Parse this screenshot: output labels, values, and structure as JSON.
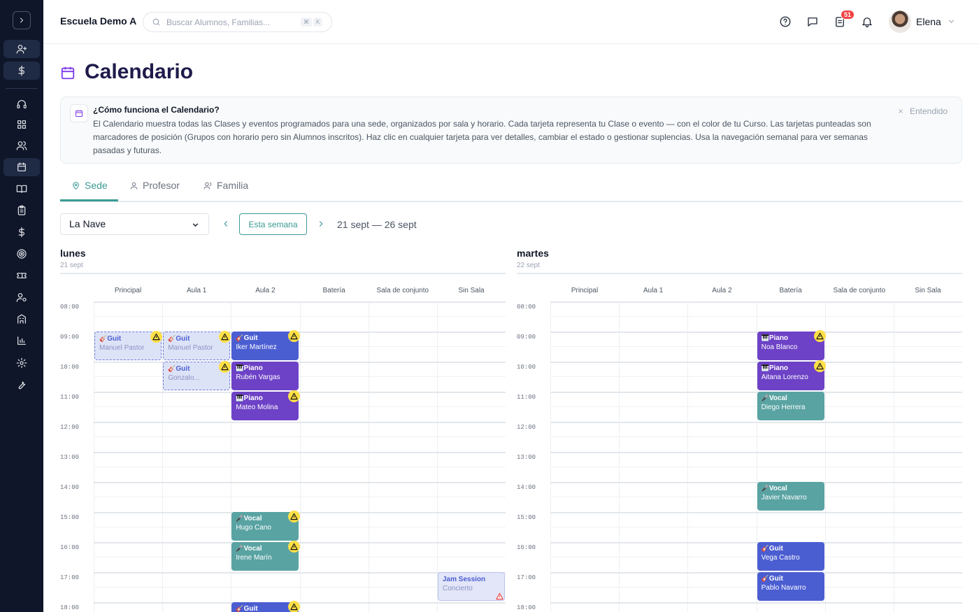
{
  "topbar": {
    "school": "Escuela Demo A",
    "search_placeholder": "Buscar Alumnos, Familias...",
    "kbd1": "⌘",
    "kbd2": "K",
    "badge_count": "51",
    "user_name": "Elena"
  },
  "page": {
    "title": "Calendario"
  },
  "info": {
    "title": "¿Cómo funciona el Calendario?",
    "text": "El Calendario muestra todas las Clases y eventos programados para una sede, organizados por sala y horario. Cada tarjeta representa tu Clase o evento — con el color de tu Curso. Las tarjetas punteadas son marcadores de posición (Grupos con horario pero sin Alumnos inscritos). Haz clic en cualquier tarjeta para ver detalles, cambiar el estado o gestionar suplencias. Usa la navegación semanal para ver semanas pasadas y futuras.",
    "dismiss": "Entendido"
  },
  "tabs": [
    {
      "label": "Sede",
      "icon": "map-pin-icon"
    },
    {
      "label": "Profesor",
      "icon": "user-icon"
    },
    {
      "label": "Familia",
      "icon": "users-icon"
    }
  ],
  "controls": {
    "venue": "La Nave",
    "this_week": "Esta semana",
    "range": "21 sept — 26 sept"
  },
  "rooms": [
    "Principal",
    "Aula 1",
    "Aula 2",
    "Batería",
    "Sala de conjunto",
    "Sin Sala"
  ],
  "times": [
    "08:00",
    "09:00",
    "10:00",
    "11:00",
    "12:00",
    "13:00",
    "14:00",
    "15:00",
    "16:00",
    "17:00",
    "18:00"
  ],
  "days": [
    {
      "name": "lunes",
      "date": "21 sept",
      "events": [
        {
          "room": 0,
          "hour": 1,
          "type": "ph",
          "icon": "🎸",
          "title": "Guit",
          "sub": "Manuel Pastor",
          "warn": true
        },
        {
          "room": 1,
          "hour": 1,
          "type": "ph",
          "icon": "🎸",
          "title": "Guit",
          "sub": "Manuel Pastor",
          "warn": true
        },
        {
          "room": 2,
          "hour": 1,
          "type": "guit",
          "icon": "🎸",
          "title": "Guit",
          "sub": "Iker Martínez",
          "warn": true
        },
        {
          "room": 1,
          "hour": 2,
          "type": "ph",
          "icon": "🎸",
          "title": "Guit",
          "sub": "Gonzalo...",
          "warn": true
        },
        {
          "room": 2,
          "hour": 2,
          "type": "piano",
          "icon": "🎹",
          "title": "Piano",
          "sub": "Rubén Vargas",
          "warn": false
        },
        {
          "room": 2,
          "hour": 3,
          "type": "piano",
          "icon": "🎹",
          "title": "Piano",
          "sub": "Mateo Molina",
          "warn": true
        },
        {
          "room": 2,
          "hour": 7,
          "type": "vocal",
          "icon": "🎤",
          "title": "Vocal",
          "sub": "Hugo Cano",
          "warn": true
        },
        {
          "room": 2,
          "hour": 8,
          "type": "vocal",
          "icon": "🎤",
          "title": "Vocal",
          "sub": "Irene Marín",
          "warn": true
        },
        {
          "room": 5,
          "hour": 9,
          "type": "jam",
          "icon": "",
          "title": "Jam Session",
          "sub": "Concierto",
          "warn": false,
          "warn_red": true
        },
        {
          "room": 2,
          "hour": 10,
          "type": "guit",
          "icon": "🎸",
          "title": "Guit",
          "sub": "",
          "warn": true
        }
      ]
    },
    {
      "name": "martes",
      "date": "22 sept",
      "events": [
        {
          "room": 3,
          "hour": 1,
          "type": "piano",
          "icon": "🎹",
          "title": "Piano",
          "sub": "Noa Blanco",
          "warn": true
        },
        {
          "room": 3,
          "hour": 2,
          "type": "piano",
          "icon": "🎹",
          "title": "Piano",
          "sub": "Aitana Lorenzo",
          "warn": true
        },
        {
          "room": 3,
          "hour": 3,
          "type": "vocal",
          "icon": "🎤",
          "title": "Vocal",
          "sub": "Diego Herrera",
          "warn": false
        },
        {
          "room": 3,
          "hour": 6,
          "type": "vocal",
          "icon": "🎤",
          "title": "Vocal",
          "sub": "Javier Navarro",
          "warn": false
        },
        {
          "room": 3,
          "hour": 8,
          "type": "guit",
          "icon": "🎸",
          "title": "Guit",
          "sub": "Vega Castro",
          "warn": false
        },
        {
          "room": 3,
          "hour": 9,
          "type": "guit",
          "icon": "🎸",
          "title": "Guit",
          "sub": "Pablo Navarro",
          "warn": false
        }
      ]
    }
  ]
}
